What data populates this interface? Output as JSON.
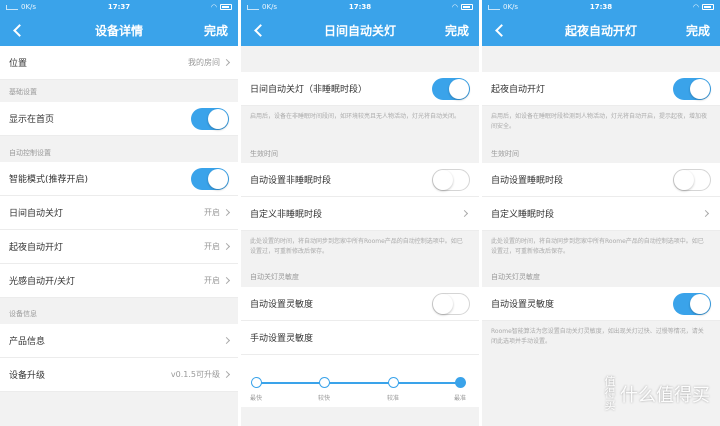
{
  "status": {
    "left_text": "0K/s",
    "time_1": "17:37",
    "time_2": "17:38",
    "time_3": "17:38"
  },
  "screens": [
    {
      "title": "设备详情",
      "done": "完成",
      "location_label": "位置",
      "location_value": "我的房间",
      "section_basic": "基础设置",
      "show_on_home": "显示在首页",
      "section_auto": "自动控制设置",
      "smart_mode": "智能模式(推荐开启)",
      "day_auto_off": "日间自动关灯",
      "day_auto_off_value": "开启",
      "night_auto_on": "起夜自动开灯",
      "night_auto_on_value": "开启",
      "light_sense": "光感自动开/关灯",
      "light_sense_value": "开启",
      "section_device": "设备信息",
      "product_info": "产品信息",
      "upgrade": "设备升级",
      "upgrade_value": "v0.1.5可升级"
    },
    {
      "title": "日间自动关灯",
      "done": "完成",
      "main_toggle": "日间自动关灯（非睡眠时段）",
      "main_desc": "启用后，设备在非睡眠时间段间，如环境较亮且无人物活动，灯光将自动关闭。",
      "section_time": "生效时间",
      "auto_set": "自动设置非睡眠时段",
      "custom": "自定义非睡眠时段",
      "time_desc": "此处设置的时间，将自动同步到您家中所有Roome产品的自动控制选项中。如已设置过，可重新修改后保存。",
      "section_sens": "自动关灯灵敏度",
      "auto_sens": "自动设置灵敏度",
      "manual_sens": "手动设置灵敏度",
      "ticks": [
        "最快",
        "较快",
        "较准",
        "最准"
      ]
    },
    {
      "title": "起夜自动开灯",
      "done": "完成",
      "main_toggle": "起夜自动开灯",
      "main_desc": "启用后，如设备在睡眠时段检测到人物活动，灯光将自动开启，提示起夜，增加夜间安全。",
      "section_time": "生效时间",
      "auto_set": "自动设置睡眠时段",
      "custom": "自定义睡眠时段",
      "time_desc": "此处设置的时间，将自动同步到您家中所有Roome产品的自动控制选项中。如已设置过，可重新修改后保存。",
      "section_sens": "自动关灯灵敏度",
      "auto_sens": "自动设置灵敏度",
      "sens_desc": "Roome智能算法为您设置自动关灯灵敏度，如出现关灯过快、过慢等情况，请关闭此选项并手动设置。"
    }
  ],
  "watermark": {
    "logo": "值得买",
    "text": "什么值得买"
  },
  "colors": {
    "accent": "#3aa3ea",
    "background": "#f2f2f2"
  }
}
